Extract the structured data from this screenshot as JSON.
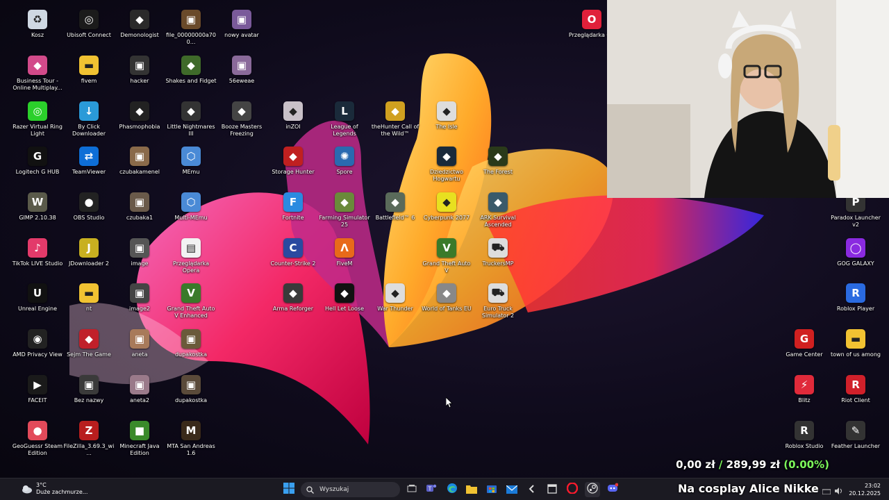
{
  "desktop": {
    "icons_left": [
      {
        "label": "Kosz",
        "icon": "recycle-bin-icon",
        "color": "#cfd8e3"
      },
      {
        "label": "Ubisoft Connect",
        "icon": "ubisoft-icon",
        "color": "#1b1b1b"
      },
      {
        "label": "Demonologist",
        "icon": "game-icon",
        "color": "#2a2a2a"
      },
      {
        "label": "file_00000000a700...",
        "icon": "image-icon",
        "color": "#6a4a2a"
      },
      {
        "label": "nowy avatar",
        "icon": "image-icon",
        "color": "#7a5a9a"
      },
      {
        "label": "Business Tour - Online Multiplay...",
        "icon": "game-icon",
        "color": "#d24a8a"
      },
      {
        "label": "fivem",
        "icon": "folder-icon",
        "color": "#f1c232"
      },
      {
        "label": "hacker",
        "icon": "image-icon",
        "color": "#333"
      },
      {
        "label": "Shakes and Fidget",
        "icon": "game-icon",
        "color": "#3f6a2a"
      },
      {
        "label": "56eweae",
        "icon": "image-icon",
        "color": "#8a6a9a"
      },
      {
        "label": "Razer Virtual Ring Light",
        "icon": "razer-icon",
        "color": "#2bd02b"
      },
      {
        "label": "By Click Downloader",
        "icon": "download-icon",
        "color": "#2a9ad8"
      },
      {
        "label": "Phasmophobia",
        "icon": "game-icon",
        "color": "#222"
      },
      {
        "label": "Little Nightmares III",
        "icon": "game-icon",
        "color": "#333"
      },
      {
        "label": "Booze Masters Freezing Moonshine",
        "icon": "game-icon",
        "color": "#444"
      },
      {
        "label": "Logitech G HUB",
        "icon": "logitech-icon",
        "color": "#111"
      },
      {
        "label": "TeamViewer",
        "icon": "teamviewer-icon",
        "color": "#0e6ed6"
      },
      {
        "label": "czubakamenel",
        "icon": "image-icon",
        "color": "#8a6a4a"
      },
      {
        "label": "MEmu",
        "icon": "memu-icon",
        "color": "#4a8ad6"
      },
      {
        "label": "GIMP 2.10.38",
        "icon": "gimp-icon",
        "color": "#5a5a4a"
      },
      {
        "label": "OBS Studio",
        "icon": "obs-icon",
        "color": "#222"
      },
      {
        "label": "czubaka1",
        "icon": "image-icon",
        "color": "#6a5a4a"
      },
      {
        "label": "Multi-MEmu",
        "icon": "memu-icon",
        "color": "#4a8ad6"
      },
      {
        "label": "TikTok LIVE Studio",
        "icon": "tiktok-icon",
        "color": "#e33a6a"
      },
      {
        "label": "JDownloader 2",
        "icon": "jdownloader-icon",
        "color": "#c8b020"
      },
      {
        "label": "image",
        "icon": "image-icon",
        "color": "#555"
      },
      {
        "label": "Przeglądarka Opera",
        "icon": "document-icon",
        "color": "#f2f2f2"
      },
      {
        "label": "Unreal Engine",
        "icon": "unreal-icon",
        "color": "#111"
      },
      {
        "label": "nt",
        "icon": "folder-icon",
        "color": "#f1c232"
      },
      {
        "label": "image2",
        "icon": "image-icon",
        "color": "#444"
      },
      {
        "label": "Grand Theft Auto V Enhanced",
        "icon": "gta-icon",
        "color": "#3a7a2a"
      },
      {
        "label": "AMD Privacy View",
        "icon": "eye-icon",
        "color": "#222"
      },
      {
        "label": "Sejm The Game",
        "icon": "game-icon",
        "color": "#c0202a"
      },
      {
        "label": "aneta",
        "icon": "image-icon",
        "color": "#a87a5a"
      },
      {
        "label": "dupakostka",
        "icon": "image-icon",
        "color": "#6a5a3a"
      },
      {
        "label": "FACEIT",
        "icon": "faceit-icon",
        "color": "#1a1a1a"
      },
      {
        "label": "Bez nazwy",
        "icon": "image-icon",
        "color": "#3a3a3a"
      },
      {
        "label": "aneta2",
        "icon": "image-icon",
        "color": "#9a7a8a"
      },
      {
        "label": "dupakostka",
        "icon": "image-icon",
        "color": "#5a4a3a"
      },
      {
        "label": "GeoGuessr Steam Edition",
        "icon": "map-pin-icon",
        "color": "#e24a5a"
      },
      {
        "label": "FileZilla_3.69.3_wi...",
        "icon": "filezilla-icon",
        "color": "#b81e1e"
      },
      {
        "label": "Minecraft Java Edition",
        "icon": "minecraft-icon",
        "color": "#3a8a2a"
      },
      {
        "label": "MTA San Andreas 1.6",
        "icon": "mta-icon",
        "color": "#3a2a1a"
      }
    ],
    "icons_middle": [
      {
        "label": "inZOI",
        "icon": "game-icon",
        "color": "#c8c0c8"
      },
      {
        "label": "League of Legends",
        "icon": "lol-icon",
        "color": "#1a2a3a"
      },
      {
        "label": "theHunter Call of the Wild™",
        "icon": "game-icon",
        "color": "#d0a020"
      },
      {
        "label": "The Isle",
        "icon": "game-icon",
        "color": "#ddd"
      },
      {
        "label": "Storage Hunter",
        "icon": "game-icon",
        "color": "#c02020"
      },
      {
        "label": "Spore",
        "icon": "spore-icon",
        "color": "#2a6ab0"
      },
      {
        "label": "Dziedzictwo Hogwartu",
        "icon": "game-icon",
        "color": "#1a2a3a"
      },
      {
        "label": "The Forest",
        "icon": "game-icon",
        "color": "#2a3a1a"
      },
      {
        "label": "Fortnite",
        "icon": "fortnite-icon",
        "color": "#2a8ae0"
      },
      {
        "label": "Farming Simulator 25",
        "icon": "game-icon",
        "color": "#6a8a3a"
      },
      {
        "label": "Battlefield™ 6",
        "icon": "game-icon",
        "color": "#5a6a5a"
      },
      {
        "label": "Cyberpunk 2077",
        "icon": "game-icon",
        "color": "#e8e020"
      },
      {
        "label": "ARK Survival Ascended",
        "icon": "game-icon",
        "color": "#3a5a6a"
      },
      {
        "label": "Counter-Strike 2",
        "icon": "cs2-icon",
        "color": "#2a4aa0"
      },
      {
        "label": "FiveM",
        "icon": "fivem-icon",
        "color": "#e86a1a"
      },
      {
        "label": "Grand Theft Auto V",
        "icon": "gta-icon",
        "color": "#3a7a2a"
      },
      {
        "label": "TruckersMP",
        "icon": "truck-icon",
        "color": "#ddd"
      },
      {
        "label": "Arma Reforger",
        "icon": "game-icon",
        "color": "#3a3a3a"
      },
      {
        "label": "Hell Let Loose",
        "icon": "game-icon",
        "color": "#111"
      },
      {
        "label": "War Thunder",
        "icon": "game-icon",
        "color": "#ddd"
      },
      {
        "label": "World of Tanks EU",
        "icon": "game-icon",
        "color": "#888"
      },
      {
        "label": "Euro Truck Simulator 2",
        "icon": "truck-icon",
        "color": "#ddd"
      }
    ],
    "icons_right": [
      {
        "label": "Przeglądarka GX",
        "icon": "opera-gx-icon",
        "color": "#e0203a"
      },
      {
        "label": "Paradox Launcher v2",
        "icon": "paradox-icon",
        "color": "#333"
      },
      {
        "label": "GOG GALAXY",
        "icon": "gog-icon",
        "color": "#8a2ae0"
      },
      {
        "label": "Roblox Player",
        "icon": "roblox-icon",
        "color": "#2a6ae0"
      },
      {
        "label": "Game Center",
        "icon": "game-center-icon",
        "color": "#d02020"
      },
      {
        "label": "town of us among",
        "icon": "folder-icon",
        "color": "#f1c232"
      },
      {
        "label": "Blitz",
        "icon": "blitz-icon",
        "color": "#e02a3a"
      },
      {
        "label": "Riot Client",
        "icon": "riot-icon",
        "color": "#d0202a"
      },
      {
        "label": "Roblox Studio",
        "icon": "roblox-studio-icon",
        "color": "#333"
      },
      {
        "label": "Feather Launcher",
        "icon": "feather-icon",
        "color": "#333"
      }
    ]
  },
  "overlay": {
    "price_current": "0,00 zł",
    "price_sep": " / ",
    "price_target": "289,99 zł",
    "price_pct": "(0.00%)",
    "caption": "Na cosplay Alice Nikke"
  },
  "taskbar": {
    "weather_temp": "3°C",
    "weather_desc": "Duże zachmurze...",
    "search_placeholder": "Wyszukaj",
    "time": "23:02",
    "date": "20.12.2025",
    "apps": [
      "start-icon",
      "search-icon",
      "task-view-icon",
      "teams-icon",
      "edge-icon",
      "file-explorer-icon",
      "store-icon",
      "mail-icon",
      "back-icon",
      "window-icon",
      "opera-icon",
      "steam-icon",
      "discord-icon"
    ]
  },
  "colors": {
    "accent": "#0078d4",
    "overlay_green": "#7cf75b",
    "taskbar_bg": "#1b1a22"
  }
}
